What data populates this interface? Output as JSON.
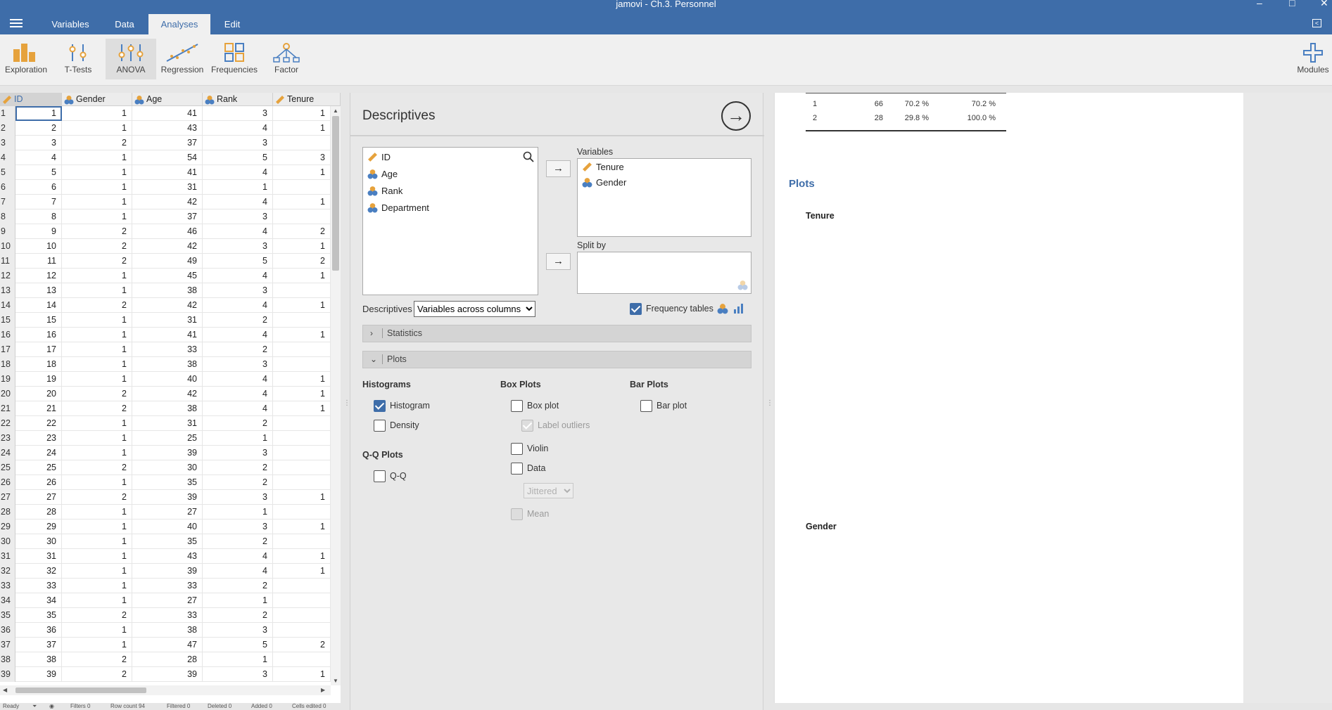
{
  "window": {
    "title": "jamovi - Ch.3. Personnel",
    "minimize": "–",
    "maximize": "□",
    "close": "✕"
  },
  "tabs": [
    "Variables",
    "Data",
    "Analyses",
    "Edit"
  ],
  "ribbon": [
    "Exploration",
    "T-Tests",
    "ANOVA",
    "Regression",
    "Frequencies",
    "Factor",
    "Modules"
  ],
  "colors": {
    "accent": "#3e6da9",
    "nominal": "#e6a23c",
    "ordinal": "#4a7fc1"
  },
  "sheet": {
    "columns": [
      "ID",
      "Gender",
      "Age",
      "Rank",
      "Tenure"
    ],
    "rows": [
      [
        1,
        1,
        1,
        41,
        3,
        1
      ],
      [
        2,
        2,
        1,
        43,
        4,
        1
      ],
      [
        3,
        3,
        2,
        37,
        3,
        ""
      ],
      [
        4,
        4,
        1,
        54,
        5,
        3
      ],
      [
        5,
        5,
        1,
        41,
        4,
        1
      ],
      [
        6,
        6,
        1,
        31,
        1,
        ""
      ],
      [
        7,
        7,
        1,
        42,
        4,
        1
      ],
      [
        8,
        8,
        1,
        37,
        3,
        ""
      ],
      [
        9,
        9,
        2,
        46,
        4,
        2
      ],
      [
        10,
        10,
        2,
        42,
        3,
        1
      ],
      [
        11,
        11,
        2,
        49,
        5,
        2
      ],
      [
        12,
        12,
        1,
        45,
        4,
        1
      ],
      [
        13,
        13,
        1,
        38,
        3,
        ""
      ],
      [
        14,
        14,
        2,
        42,
        4,
        1
      ],
      [
        15,
        15,
        1,
        31,
        2,
        ""
      ],
      [
        16,
        16,
        1,
        41,
        4,
        1
      ],
      [
        17,
        17,
        1,
        33,
        2,
        ""
      ],
      [
        18,
        18,
        1,
        38,
        3,
        ""
      ],
      [
        19,
        19,
        1,
        40,
        4,
        1
      ],
      [
        20,
        20,
        2,
        42,
        4,
        1
      ],
      [
        21,
        21,
        2,
        38,
        4,
        1
      ],
      [
        22,
        22,
        1,
        31,
        2,
        ""
      ],
      [
        23,
        23,
        1,
        25,
        1,
        ""
      ],
      [
        24,
        24,
        1,
        39,
        3,
        ""
      ],
      [
        25,
        25,
        2,
        30,
        2,
        ""
      ],
      [
        26,
        26,
        1,
        35,
        2,
        ""
      ],
      [
        27,
        27,
        2,
        39,
        3,
        1
      ],
      [
        28,
        28,
        1,
        27,
        1,
        ""
      ],
      [
        29,
        29,
        1,
        40,
        3,
        1
      ],
      [
        30,
        30,
        1,
        35,
        2,
        ""
      ],
      [
        31,
        31,
        1,
        43,
        4,
        1
      ],
      [
        32,
        32,
        1,
        39,
        4,
        1
      ],
      [
        33,
        33,
        1,
        33,
        2,
        ""
      ],
      [
        34,
        34,
        1,
        27,
        1,
        ""
      ],
      [
        35,
        35,
        2,
        33,
        2,
        ""
      ],
      [
        36,
        36,
        1,
        38,
        3,
        ""
      ],
      [
        37,
        37,
        1,
        47,
        5,
        2
      ],
      [
        38,
        38,
        2,
        28,
        1,
        ""
      ],
      [
        39,
        39,
        2,
        39,
        3,
        1
      ]
    ]
  },
  "status": {
    "ready": "Ready",
    "filters": "Filters 0",
    "row_count": "Row count 94",
    "filtered": "Filtered 0",
    "deleted": "Deleted 0",
    "added": "Added 0",
    "cells_edited": "Cells edited 0"
  },
  "options": {
    "title": "Descriptives",
    "available_vars": [
      "ID",
      "Age",
      "Rank",
      "Department"
    ],
    "variables_label": "Variables",
    "selected_vars": [
      "Tenure",
      "Gender"
    ],
    "split_label": "Split by",
    "descriptives_label": "Descriptives",
    "descriptives_select": "Variables across columns",
    "freq_tables": "Frequency tables",
    "statistics": "Statistics",
    "plots": "Plots",
    "histograms": "Histograms",
    "histogram": "Histogram",
    "density": "Density",
    "qq_plots": "Q-Q Plots",
    "qq": "Q-Q",
    "box_plots": "Box Plots",
    "box_plot": "Box plot",
    "label_outliers": "Label outliers",
    "violin": "Violin",
    "data": "Data",
    "jittered": "Jittered",
    "mean": "Mean",
    "bar_plots": "Bar Plots",
    "bar_plot": "Bar plot"
  },
  "results": {
    "freq_rows": [
      [
        "1",
        "66",
        "70.2 %",
        "70.2 %"
      ],
      [
        "2",
        "28",
        "29.8 %",
        "100.0 %"
      ]
    ],
    "plots_heading": "Plots",
    "plot_titles": [
      "Tenure",
      "Gender"
    ]
  }
}
